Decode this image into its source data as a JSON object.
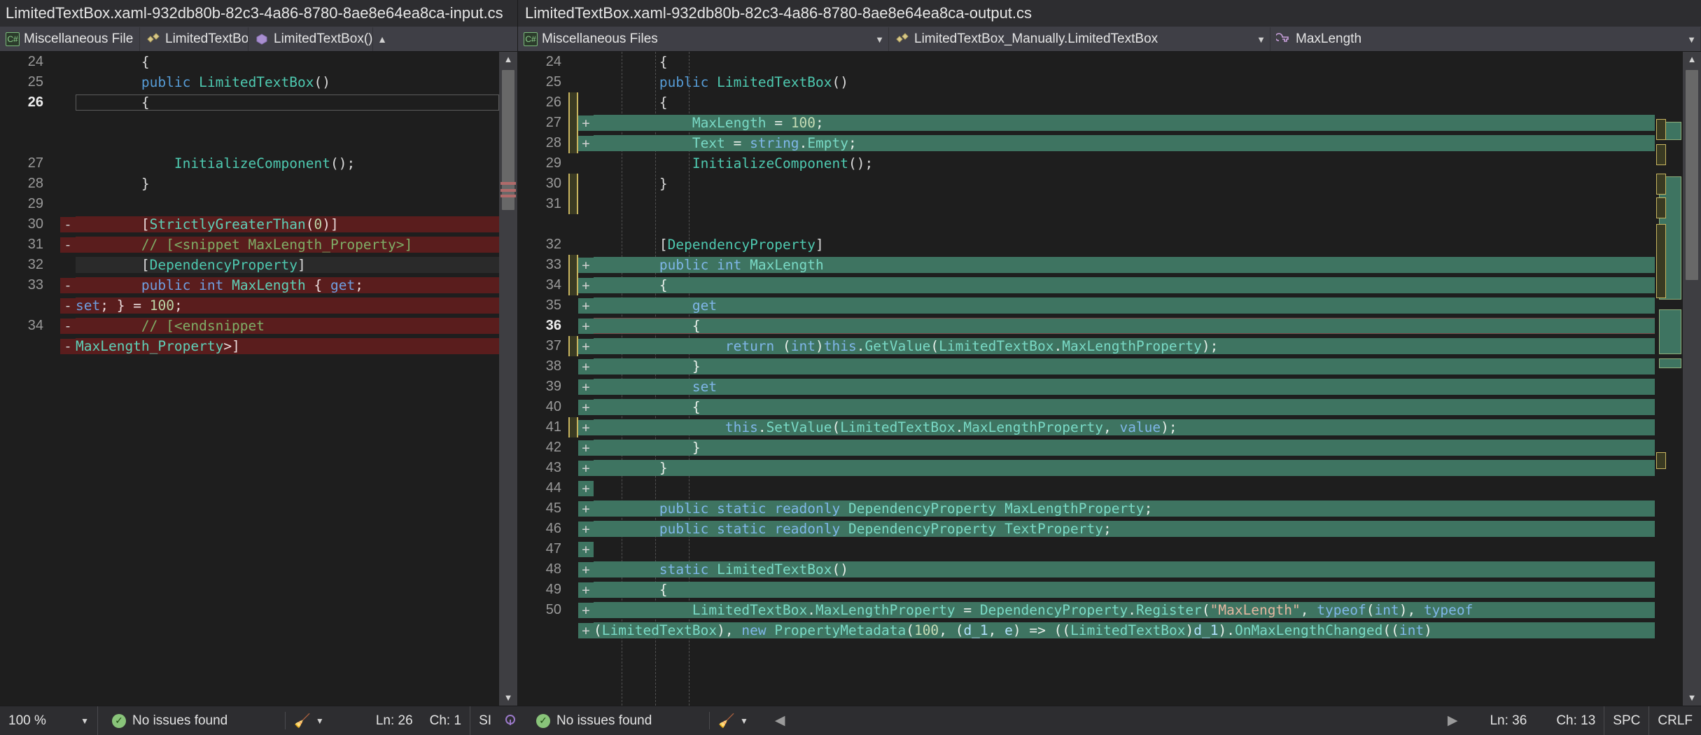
{
  "panes": {
    "left": {
      "title": "LimitedTextBox.xaml-932db80b-82c3-4a86-8780-8ae8e64ea8ca-input.cs",
      "nav": [
        {
          "label": "Miscellaneous File",
          "icon": "cs-file-icon"
        },
        {
          "label": "LimitedTextBox_M.",
          "icon": "class-icon"
        },
        {
          "label": "LimitedTextBox()",
          "icon": "method-icon"
        }
      ],
      "lines": [
        {
          "num": "24",
          "kind": "plain",
          "sign": "",
          "text": "        {"
        },
        {
          "num": "25",
          "kind": "plain",
          "sign": "",
          "text": "        public LimitedTextBox()"
        },
        {
          "num": "26",
          "kind": "plain",
          "sign": "",
          "text": "        {",
          "current": true
        },
        {
          "num": "",
          "kind": "hatch",
          "sign": "",
          "text": ""
        },
        {
          "num": "",
          "kind": "hatch",
          "sign": "",
          "text": ""
        },
        {
          "num": "27",
          "kind": "plain",
          "sign": "",
          "text": "            InitializeComponent();"
        },
        {
          "num": "28",
          "kind": "plain",
          "sign": "",
          "text": "        }"
        },
        {
          "num": "29",
          "kind": "plain",
          "sign": "",
          "text": ""
        },
        {
          "num": "30",
          "kind": "del",
          "sign": "-",
          "text": "        [StrictlyGreaterThan(0)]"
        },
        {
          "num": "31",
          "kind": "del",
          "sign": "-",
          "text": "        // [<snippet MaxLength_Property>]"
        },
        {
          "num": "32",
          "kind": "ctx",
          "sign": "",
          "text": "        [DependencyProperty]"
        },
        {
          "num": "33",
          "kind": "del",
          "sign": "-",
          "text": "        public int MaxLength { get;"
        },
        {
          "num": "",
          "kind": "del",
          "sign": "-",
          "text": "set; } = 100;"
        },
        {
          "num": "34",
          "kind": "del",
          "sign": "-",
          "text": "        // [<endsnippet"
        },
        {
          "num": "",
          "kind": "del",
          "sign": "-",
          "text": "MaxLength_Property>]"
        }
      ]
    },
    "right": {
      "title": "LimitedTextBox.xaml-932db80b-82c3-4a86-8780-8ae8e64ea8ca-output.cs",
      "nav": [
        {
          "label": "Miscellaneous Files",
          "icon": "cs-file-icon"
        },
        {
          "label": "LimitedTextBox_Manually.LimitedTextBox",
          "icon": "class-icon"
        },
        {
          "label": "MaxLength",
          "icon": "property-icon"
        }
      ],
      "lines": [
        {
          "num": "24",
          "kind": "plain",
          "sign": "",
          "mark": false,
          "text": "        {"
        },
        {
          "num": "25",
          "kind": "plain",
          "sign": "",
          "mark": false,
          "text": "        public LimitedTextBox()"
        },
        {
          "num": "26",
          "kind": "plain",
          "sign": "",
          "mark": true,
          "text": "        {"
        },
        {
          "num": "27",
          "kind": "add",
          "sign": "+",
          "mark": true,
          "text": "            MaxLength = 100;"
        },
        {
          "num": "28",
          "kind": "add",
          "sign": "+",
          "mark": true,
          "text": "            Text = string.Empty;"
        },
        {
          "num": "29",
          "kind": "plain",
          "sign": "",
          "mark": false,
          "text": "            InitializeComponent();"
        },
        {
          "num": "30",
          "kind": "plain",
          "sign": "",
          "mark": true,
          "text": "        }"
        },
        {
          "num": "31",
          "kind": "plain",
          "sign": "",
          "mark": true,
          "text": ""
        },
        {
          "num": "",
          "kind": "hatch",
          "sign": "",
          "mark": false,
          "text": ""
        },
        {
          "num": "32",
          "kind": "plain",
          "sign": "",
          "mark": false,
          "text": "        [DependencyProperty]"
        },
        {
          "num": "33",
          "kind": "add",
          "sign": "+",
          "mark": true,
          "text": "        public int MaxLength"
        },
        {
          "num": "34",
          "kind": "add",
          "sign": "+",
          "mark": true,
          "text": "        {"
        },
        {
          "num": "35",
          "kind": "add",
          "sign": "+",
          "mark": false,
          "text": "            get"
        },
        {
          "num": "36",
          "kind": "add",
          "sign": "+",
          "mark": false,
          "text": "            {",
          "current": true
        },
        {
          "num": "37",
          "kind": "add",
          "sign": "+",
          "mark": true,
          "text": "                return (int)this.GetValue(LimitedTextBox.MaxLengthProperty);"
        },
        {
          "num": "38",
          "kind": "add",
          "sign": "+",
          "mark": false,
          "text": "            }"
        },
        {
          "num": "39",
          "kind": "add",
          "sign": "+",
          "mark": false,
          "text": "            set"
        },
        {
          "num": "40",
          "kind": "add",
          "sign": "+",
          "mark": false,
          "text": "            {"
        },
        {
          "num": "41",
          "kind": "add",
          "sign": "+",
          "mark": true,
          "text": "                this.SetValue(LimitedTextBox.MaxLengthProperty, value);"
        },
        {
          "num": "42",
          "kind": "add",
          "sign": "+",
          "mark": false,
          "text": "            }"
        },
        {
          "num": "43",
          "kind": "add",
          "sign": "+",
          "mark": false,
          "text": "        }"
        },
        {
          "num": "44",
          "kind": "add",
          "sign": "+",
          "mark": false,
          "text": ""
        },
        {
          "num": "45",
          "kind": "add",
          "sign": "+",
          "mark": false,
          "text": "        public static readonly DependencyProperty MaxLengthProperty;"
        },
        {
          "num": "46",
          "kind": "add",
          "sign": "+",
          "mark": false,
          "text": "        public static readonly DependencyProperty TextProperty;"
        },
        {
          "num": "47",
          "kind": "add",
          "sign": "+",
          "mark": false,
          "text": ""
        },
        {
          "num": "48",
          "kind": "add",
          "sign": "+",
          "mark": false,
          "text": "        static LimitedTextBox()"
        },
        {
          "num": "49",
          "kind": "add",
          "sign": "+",
          "mark": false,
          "text": "        {"
        },
        {
          "num": "50",
          "kind": "add",
          "sign": "+",
          "mark": false,
          "text": "            LimitedTextBox.MaxLengthProperty = DependencyProperty.Register(\"MaxLength\", typeof(int), typeof"
        },
        {
          "num": "",
          "kind": "add",
          "sign": "+",
          "mark": false,
          "text": "(LimitedTextBox), new PropertyMetadata(100, (d_1, e) => ((LimitedTextBox)d_1).OnMaxLengthChanged((int)"
        }
      ]
    }
  },
  "status": {
    "zoom": "100 %",
    "left_issues": "No issues found",
    "left_ln": "Ln: 26",
    "left_ch": "Ch: 1",
    "left_spc": "SI",
    "right_issues": "No issues found",
    "right_ln": "Ln: 36",
    "right_ch": "Ch: 13",
    "right_spc": "SPC",
    "right_eol": "CRLF",
    "broom_icon": "broom-icon",
    "ok_icon": "check-circle-icon"
  },
  "colors": {
    "added": "#3e7461",
    "deleted": "#5a1d1d",
    "accent": "#c8b560",
    "editor_bg": "#1e1e1e",
    "chrome_bg": "#2d2d30"
  }
}
